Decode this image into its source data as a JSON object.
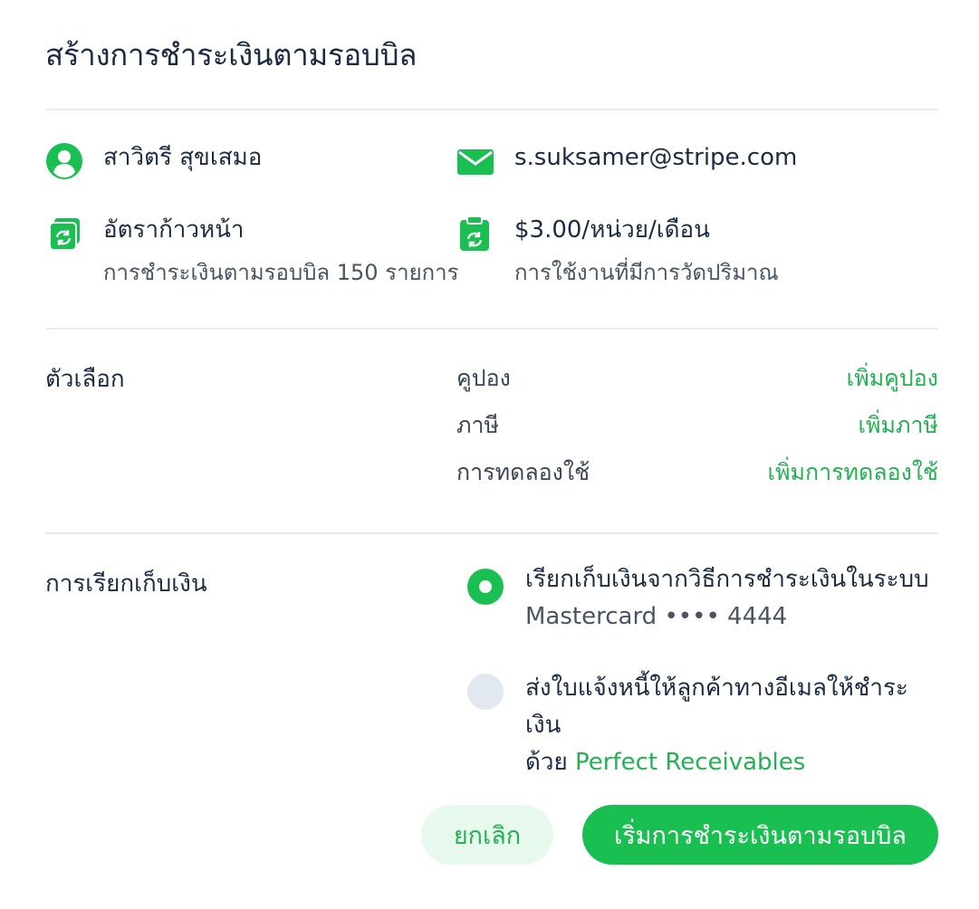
{
  "dialog": {
    "title": "สร้างการชำระเงินตามรอบบิล"
  },
  "customer": {
    "name": "สาวิตรี สุขเสมอ",
    "email": "s.suksamer@stripe.com",
    "icons": {
      "person": "person-icon",
      "email": "envelope-icon"
    }
  },
  "plan": {
    "name": "อัตราก้าวหน้า",
    "detail": "การชำระเงินตามรอบบิล 150 รายการ",
    "price": "$3.00/หน่วย/เดือน",
    "price_detail": "การใช้งานที่มีการวัดปริมาณ",
    "icons": {
      "plan": "recurring-stack-icon",
      "price": "recurring-clipboard-icon"
    }
  },
  "options": {
    "label": "ตัวเลือก",
    "rows": [
      {
        "name": "คูปอง",
        "action": "เพิ่มคูปอง"
      },
      {
        "name": "ภาษี",
        "action": "เพิ่มภาษี"
      },
      {
        "name": "การทดลองใช้",
        "action": "เพิ่มการทดลองใช้"
      }
    ]
  },
  "billing": {
    "label": "การเรียกเก็บเงิน",
    "choices": [
      {
        "line1": "เรียกเก็บเงินจากวิธีการชำระเงินในระบบ",
        "line2": "Mastercard •••• 4444",
        "selected": true
      },
      {
        "line1": "ส่งใบแจ้งหนี้ให้ลูกค้าทางอีเมลให้ชำระเงิน",
        "line2_prefix": "ด้วย",
        "line2_link": "Perfect Receivables",
        "selected": false
      }
    ]
  },
  "actions": {
    "cancel": "ยกเลิก",
    "start": "เริ่มการชำระเงินตามรอบบิล"
  },
  "colors": {
    "accent": "#19bf50",
    "link": "#23b152",
    "text": "#1a2b44",
    "muted": "#4a5563",
    "divider": "#e8ecf0"
  }
}
